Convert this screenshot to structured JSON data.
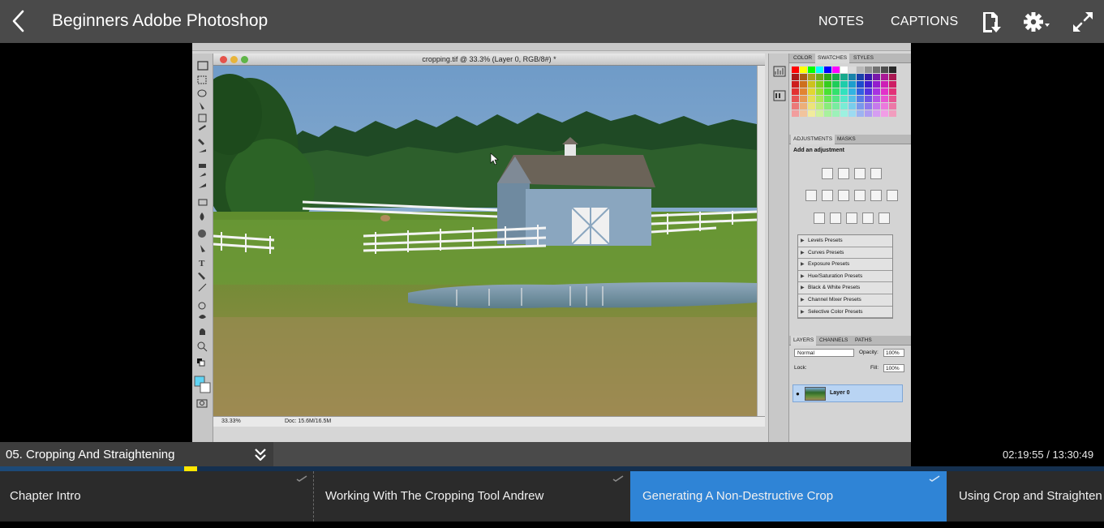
{
  "header": {
    "title": "Beginners Adobe Photoshop",
    "notes_label": "NOTES",
    "captions_label": "CAPTIONS",
    "icons": [
      "back-arrow-icon",
      "download-icon",
      "settings-icon",
      "expand-icon"
    ]
  },
  "video": {
    "document_title": "cropping.tif @ 33.3% (Layer 0, RGB/8#) *",
    "zoom_readout": "33.33%",
    "doc_size": "Doc: 15.6M/16.5M",
    "panel_tabs_top": [
      "COLOR",
      "SWATCHES",
      "STYLES"
    ],
    "adjustments_tabs": [
      "ADJUSTMENTS",
      "MASKS"
    ],
    "adjustments_title": "Add an adjustment",
    "presets": [
      "Levels Presets",
      "Curves Presets",
      "Exposure Presets",
      "Hue/Saturation Presets",
      "Black & White Presets",
      "Channel Mixer Presets",
      "Selective Color Presets"
    ],
    "layers_tabs": [
      "LAYERS",
      "CHANNELS",
      "PATHS"
    ],
    "blend_mode": "Normal",
    "opacity_label": "Opacity:",
    "opacity_value": "100%",
    "lock_label": "Lock:",
    "fill_label": "Fill:",
    "fill_value": "100%",
    "layer_name": "Layer 0"
  },
  "chapter": {
    "label": "05. Cropping And Straightening",
    "elapsed": "02:19:55",
    "total": " / 13:30:49"
  },
  "progress": {
    "fraction": 0.1725
  },
  "lessons": [
    {
      "label": "Chapter Intro",
      "watched": true,
      "active": false
    },
    {
      "label": "Working With The Cropping Tool Andrew",
      "watched": true,
      "active": false
    },
    {
      "label": "Generating A Non-Destructive Crop",
      "watched": true,
      "active": true
    },
    {
      "label": "Using Crop and Straighten",
      "watched": false,
      "active": false
    }
  ],
  "colors": {
    "topbar": "#4a4a4a",
    "active_lesson": "#2f84d6",
    "progress_marker": "#ffe600",
    "progress_track": "#15304f"
  }
}
